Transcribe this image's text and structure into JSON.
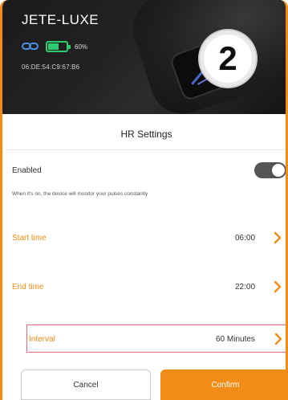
{
  "header": {
    "device_name": "JETE-LUXE",
    "battery_percent_text": "60%",
    "battery_level": 0.6,
    "mac_address": "06:DE:54:C9:67:B6",
    "step_number": "2"
  },
  "settings": {
    "title": "HR Settings",
    "enabled_label": "Enabled",
    "enabled_state": "off",
    "hint": "When it's on, the device will monitor your pulses constantly",
    "start_time_label": "Start time",
    "start_time_value": "06:00",
    "end_time_label": "End time",
    "end_time_value": "22:00",
    "interval_label": "Interval",
    "interval_value": "60 Minutes"
  },
  "buttons": {
    "cancel": "Cancel",
    "confirm": "Confirm"
  },
  "colors": {
    "accent": "#f28c18",
    "highlight_border": "#e36a7d",
    "link_icon": "#4a90e2",
    "battery": "#2ecc71"
  },
  "icons": [
    "link-icon",
    "battery-icon",
    "chevron-right-icon"
  ]
}
